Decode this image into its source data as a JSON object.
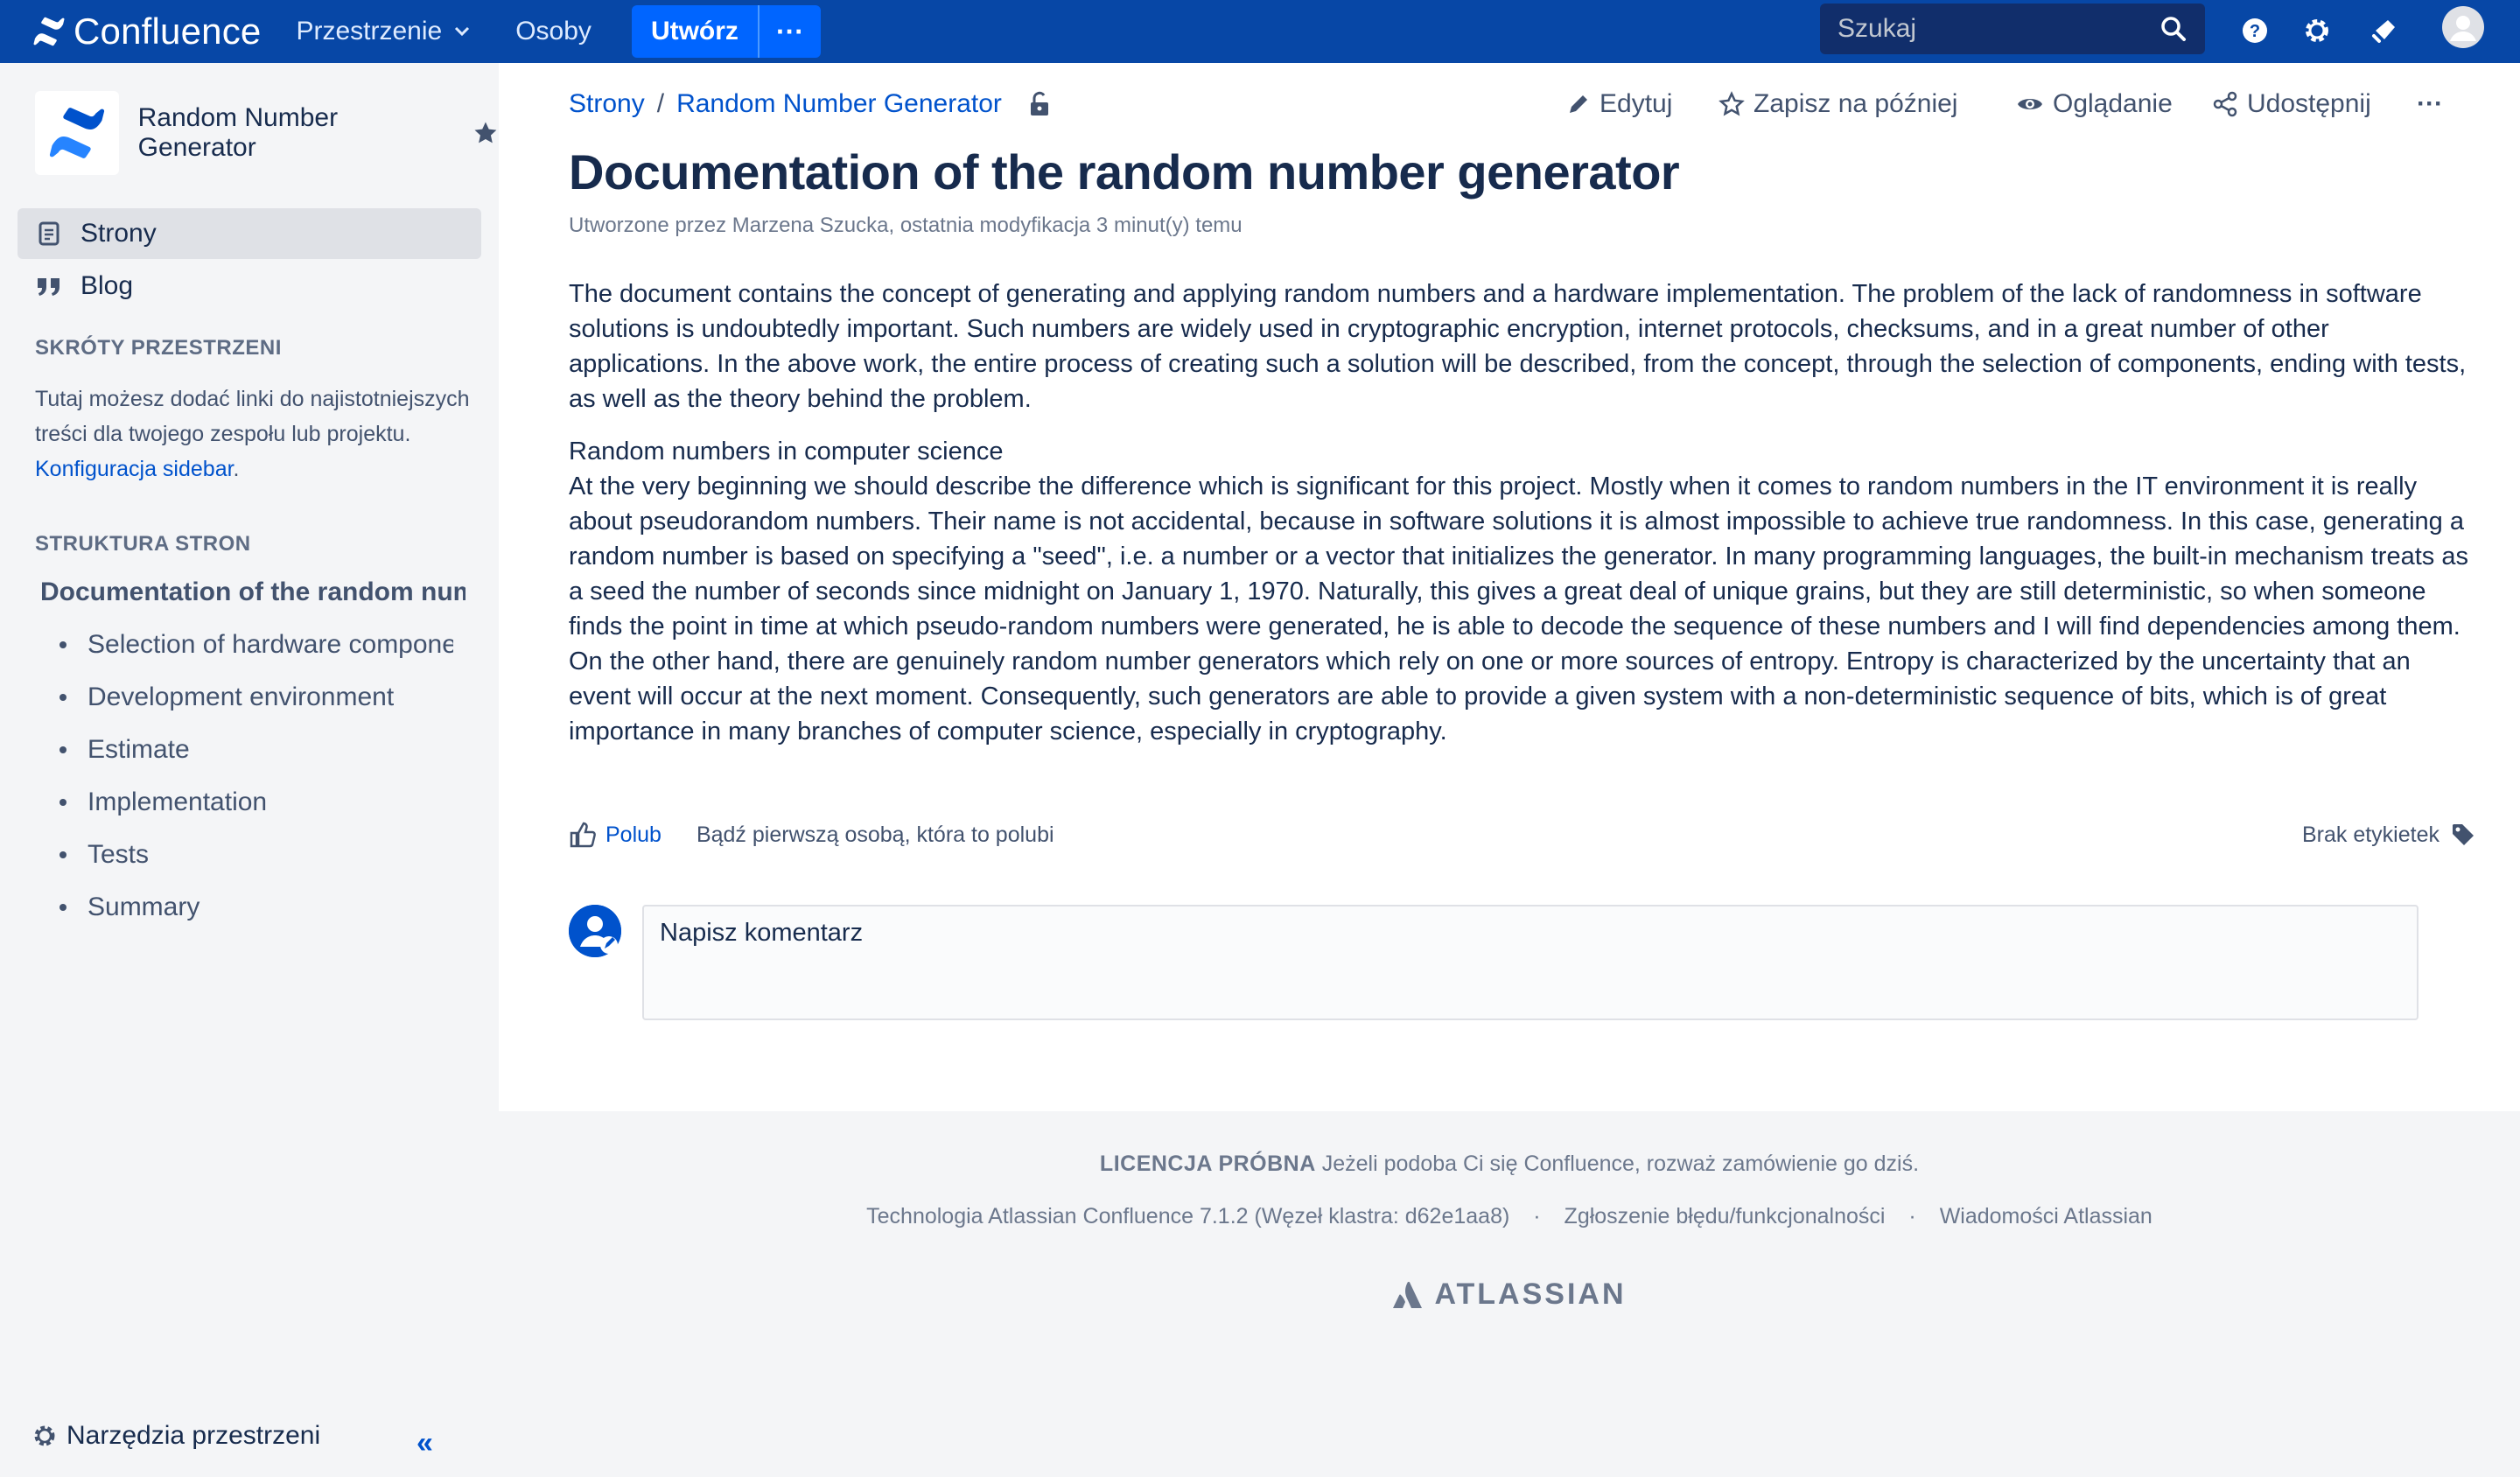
{
  "topbar": {
    "logo_text": "Confluence",
    "spaces_label": "Przestrzenie",
    "people_label": "Osoby",
    "create_label": "Utwórz",
    "create_more_label": "···",
    "search_placeholder": "Szukaj",
    "colors": {
      "bar": "#0747a6",
      "create": "#0065ff"
    }
  },
  "sidebar": {
    "space_name": "Random Number Generator",
    "nav": [
      {
        "label": "Strony",
        "icon": "pages-icon",
        "active": true
      },
      {
        "label": "Blog",
        "icon": "quote-icon",
        "active": false
      }
    ],
    "shortcuts_heading": "SKRÓTY PRZESTRZENI",
    "shortcuts_text": "Tutaj możesz dodać linki do najistotniejszych treści dla twojego zespołu lub projektu.",
    "shortcuts_link": "Konfiguracja sidebar",
    "shortcuts_suffix": ".",
    "tree_heading": "STRUKTURA STRON",
    "tree_root": "Documentation of the random number generator",
    "tree_children": [
      "Selection of hardware components",
      "Development environment",
      "Estimate",
      "Implementation",
      "Tests",
      "Summary"
    ],
    "tools_label": "Narzędzia przestrzeni",
    "collapse_icon": "«",
    "resize_handle": "||"
  },
  "page": {
    "breadcrumb": [
      "Strony",
      "Random Number Generator"
    ],
    "breadcrumb_sep": "/",
    "actions": {
      "edit": "Edytuj",
      "save": "Zapisz na później",
      "watch": "Oglądanie",
      "share": "Udostępnij",
      "more": "···"
    },
    "title": "Documentation of the random number generator",
    "byline": "Utworzone przez Marzena Szucka, ostatnia modyfikacja 3 minut(y) temu",
    "paragraphs": [
      "The document contains the concept of generating and applying random numbers and a hardware implementation. The problem of the lack of randomness in software solutions is undoubtedly important. Such numbers are widely used in cryptographic encryption, internet protocols, checksums, and in a great number of other applications. In the above work, the entire process of creating such a solution will be described, from the concept, through the selection of components, ending with tests, as well as the theory behind the problem.",
      "Random numbers in computer science",
      "At the very beginning we should describe the difference which is significant for this project. Mostly when it comes to random numbers in the IT environment it is really about pseudorandom numbers. Their name is not accidental, because in software solutions it is almost impossible to achieve true randomness. In this case, generating a random number is based on specifying a \"seed\", i.e. a number or a vector that initializes the generator. In many programming languages, the built-in mechanism treats as a seed the number of seconds since midnight on January 1, 1970. Naturally, this gives a great deal of unique grains, but they are still deterministic, so when someone finds the point in time at which pseudo-random numbers were generated, he is able to decode the sequence of these numbers and I will find dependencies among them.",
      "On the other hand, there are genuinely random number generators which rely on one or more sources of entropy. Entropy is characterized by the uncertainty that an event will occur at the next moment. Consequently, such generators are able to provide a given system with a non-deterministic sequence of bits, which is of great importance in many branches of computer science, especially in cryptography."
    ],
    "like_label": "Polub",
    "like_note": "Bądź pierwszą osobą, która to polubi",
    "labels_text": "Brak etykietek",
    "comment_placeholder": "Napisz komentarz"
  },
  "footer": {
    "license_label": "LICENCJA PRÓBNA",
    "license_text": "Jeżeli podoba Ci się Confluence, rozważ zamówienie go dziś.",
    "tech": "Technologia Atlassian Confluence 7.1.2 (Węzeł klastra: d62e1aa8)",
    "bug_link": "Zgłoszenie błędu/funkcjonalności",
    "news_link": "Wiadomości Atlassian",
    "separator": "·",
    "brand": "ATLASSIAN"
  }
}
